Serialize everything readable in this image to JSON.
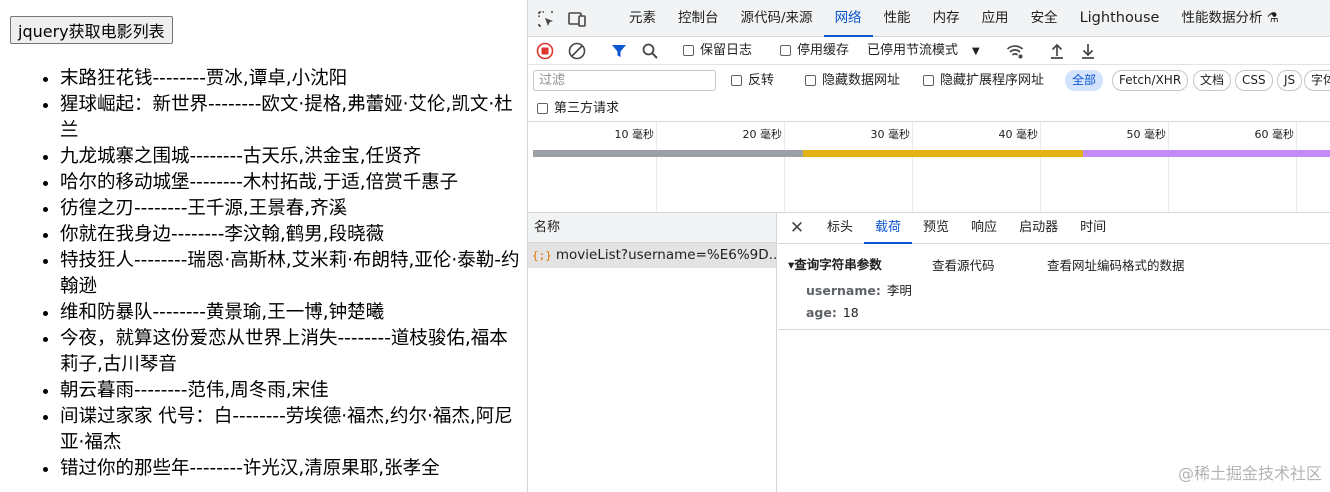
{
  "page": {
    "button_label": "jquery获取电影列表",
    "movies": [
      "末路狂花钱--------贾冰,谭卓,小沈阳",
      "猩球崛起：新世界--------欧文·提格,弗蕾娅·艾伦,凯文·杜兰",
      "九龙城寨之围城--------古天乐,洪金宝,任贤齐",
      "哈尔的移动城堡--------木村拓哉,于适,倍赏千惠子",
      "彷徨之刃--------王千源,王景春,齐溪",
      "你就在我身边--------李汶翰,鹤男,段晓薇",
      "特技狂人--------瑞恩·高斯林,艾米莉·布朗特,亚伦·泰勒-约翰逊",
      "维和防暴队--------黄景瑜,王一博,钟楚曦",
      "今夜，就算这份爱恋从世界上消失--------道枝骏佑,福本莉子,古川琴音",
      "朝云暮雨--------范伟,周冬雨,宋佳",
      "间谍过家家 代号：白--------劳埃德·福杰,约尔·福杰,阿尼亚·福杰",
      "错过你的那些年--------许光汉,清原果耶,张孝全"
    ]
  },
  "devtools": {
    "tabs": [
      "元素",
      "控制台",
      "源代码/来源",
      "网络",
      "性能",
      "内存",
      "应用",
      "安全",
      "Lighthouse",
      "性能数据分析 ⚗"
    ],
    "active_tab": "网络",
    "toolbar": {
      "preserve_log": "保留日志",
      "disable_cache": "停用缓存",
      "throttle": "已停用节流模式"
    },
    "filter": {
      "placeholder": "过滤",
      "invert": "反转",
      "hide_data_urls": "隐藏数据网址",
      "hide_extension_urls": "隐藏扩展程序网址",
      "types": [
        "全部",
        "Fetch/XHR",
        "文档",
        "CSS",
        "JS",
        "字体"
      ],
      "active_type": "全部",
      "third_party": "第三方请求"
    },
    "timeline": {
      "ticks": [
        "10 毫秒",
        "20 毫秒",
        "30 毫秒",
        "40 毫秒",
        "50 毫秒",
        "60 毫秒"
      ],
      "colors": {
        "queue": "#9aa0a6",
        "waiting": "#e3b214",
        "download": "#c58af9"
      }
    },
    "requests": {
      "header": "名称",
      "items": [
        "movieList?username=%E6%9D..."
      ]
    },
    "detail": {
      "close": "✕",
      "tabs": [
        "标头",
        "载荷",
        "预览",
        "响应",
        "启动器",
        "时间"
      ],
      "active_tab": "载荷",
      "section_title": "▾查询字符串参数",
      "view_source": "查看源代码",
      "view_url_encoded": "查看网址编码格式的数据",
      "params": [
        {
          "key": "username:",
          "value": "李明"
        },
        {
          "key": "age:",
          "value": "18"
        }
      ]
    },
    "colors": {
      "accent": "#0b57d0",
      "record_stop": "#dc362e"
    }
  },
  "watermark": "@稀土掘金技术社区"
}
